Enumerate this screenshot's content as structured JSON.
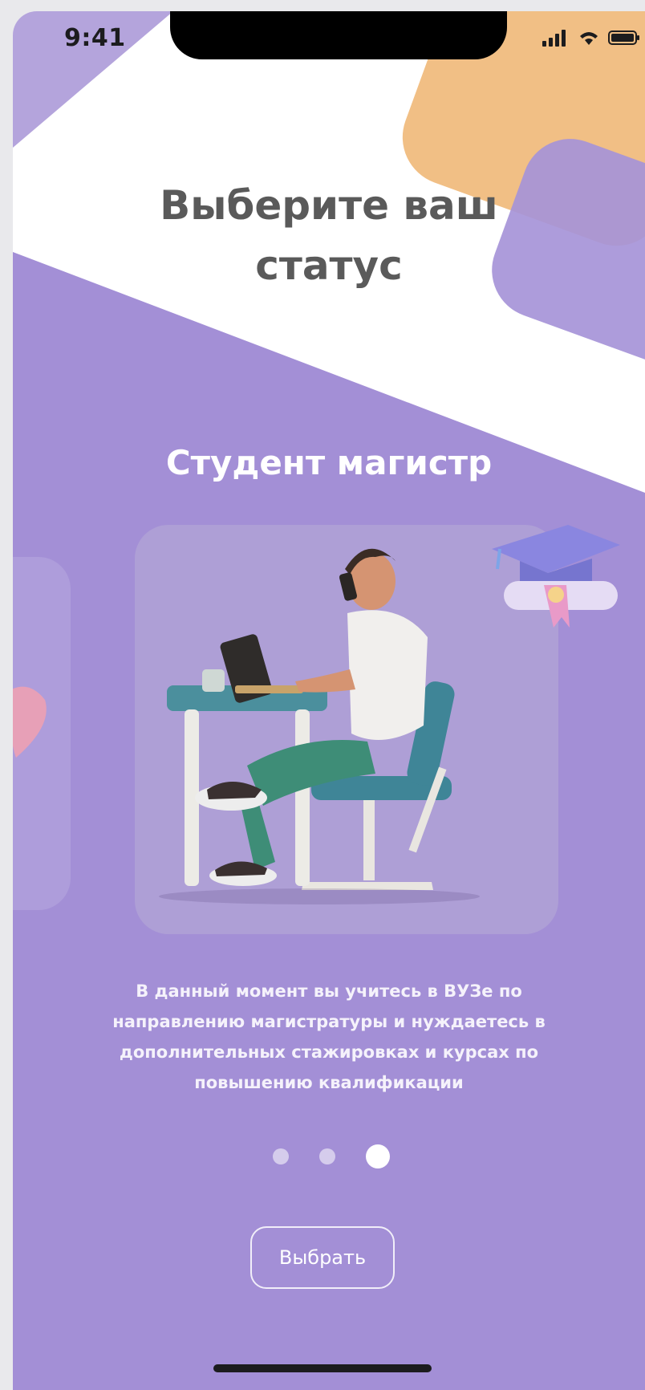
{
  "status_bar": {
    "time": "9:41",
    "icons": [
      "cellular-signal-icon",
      "wifi-icon",
      "battery-icon"
    ]
  },
  "screen": {
    "title_line1": "Выберите ваш",
    "title_line2": "статус",
    "card_title": "Студент магистр",
    "description": "В данный момент вы учитесь в ВУЗе по направлению магистратуры и нуждаетесь в дополнительных стажировках и курсах по повышению квалификации",
    "pagination": {
      "total": 3,
      "active_index": 3
    },
    "select_button_label": "Выбрать"
  },
  "colors": {
    "background": "#a38fd6",
    "accent_orange": "#f1bf85",
    "title_text": "#5a5a5a",
    "white": "#ffffff"
  }
}
